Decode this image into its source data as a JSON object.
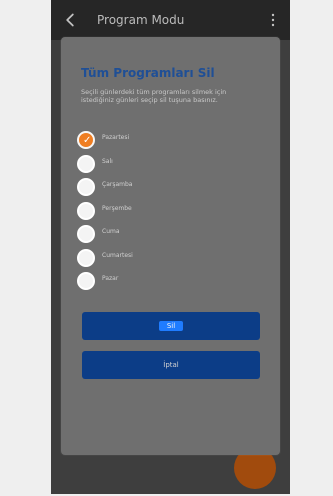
{
  "appbar": {
    "title": "Program Modu",
    "back_icon": "arrow-left-icon",
    "menu_icon": "more-vertical-icon"
  },
  "dialog": {
    "title": "Tüm Programları Sil",
    "description": "Seçili günlerdeki tüm programları silmek için istediğiniz günleri seçip sil tuşuna basınız.",
    "days": [
      {
        "label": "Pazartesi",
        "selected": true
      },
      {
        "label": "Salı",
        "selected": false
      },
      {
        "label": "Çarşamba",
        "selected": false
      },
      {
        "label": "Perşembe",
        "selected": false
      },
      {
        "label": "Cuma",
        "selected": false
      },
      {
        "label": "Cumartesi",
        "selected": false
      },
      {
        "label": "Pazar",
        "selected": false
      }
    ],
    "primary_button": "Sil",
    "secondary_button": "İptal"
  },
  "colors": {
    "accent": "#ef7e22",
    "primary": "#0c3d87",
    "title": "#1f4f96",
    "fab": "#b14a00"
  }
}
